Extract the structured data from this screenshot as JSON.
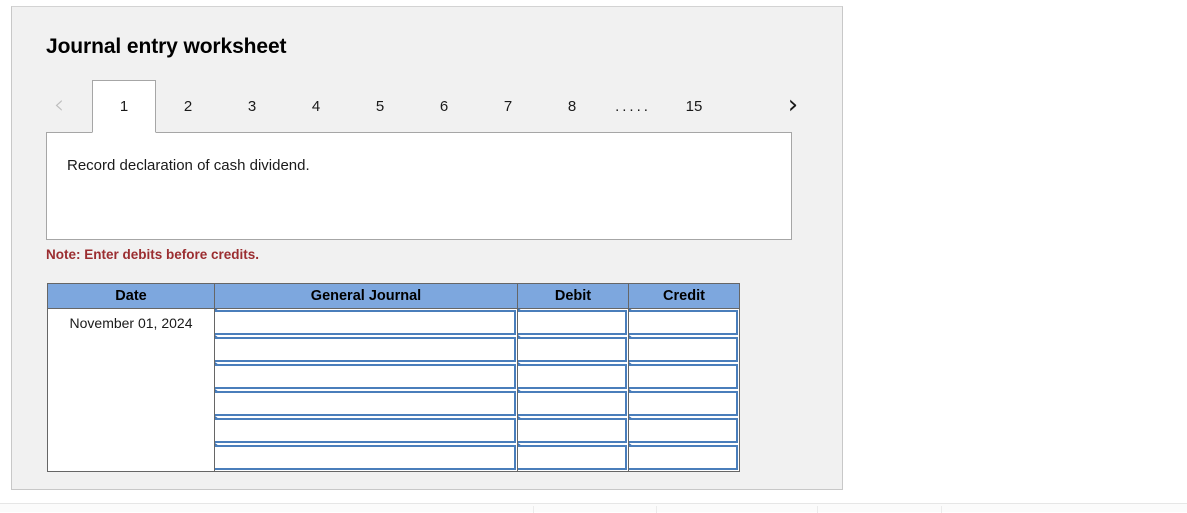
{
  "panel": {
    "title": "Journal entry worksheet"
  },
  "pagination": {
    "prev_icon": "chevron-left-icon",
    "next_icon": "chevron-right-icon",
    "prev_glyph": "‹",
    "next_glyph": "›",
    "active_page": "1",
    "tabs": [
      {
        "label": "1",
        "active": true
      },
      {
        "label": "2",
        "active": false
      },
      {
        "label": "3",
        "active": false
      },
      {
        "label": "4",
        "active": false
      },
      {
        "label": "5",
        "active": false
      },
      {
        "label": "6",
        "active": false
      },
      {
        "label": "7",
        "active": false
      },
      {
        "label": "8",
        "active": false
      },
      {
        "label": ".....",
        "active": false,
        "ellipsis": true
      },
      {
        "label": "15",
        "active": false
      }
    ]
  },
  "entry": {
    "description": "Record declaration of cash dividend."
  },
  "note": {
    "text": "Note: Enter debits before credits."
  },
  "journal_table": {
    "columns": [
      {
        "key": "date",
        "label": "Date"
      },
      {
        "key": "general_journal",
        "label": "General Journal"
      },
      {
        "key": "debit",
        "label": "Debit"
      },
      {
        "key": "credit",
        "label": "Credit"
      }
    ],
    "rows": [
      {
        "date": "November 01, 2024",
        "general_journal": "",
        "debit": "",
        "credit": ""
      },
      {
        "date": "",
        "general_journal": "",
        "debit": "",
        "credit": ""
      },
      {
        "date": "",
        "general_journal": "",
        "debit": "",
        "credit": ""
      },
      {
        "date": "",
        "general_journal": "",
        "debit": "",
        "credit": ""
      },
      {
        "date": "",
        "general_journal": "",
        "debit": "",
        "credit": ""
      },
      {
        "date": "",
        "general_journal": "",
        "debit": "",
        "credit": ""
      }
    ]
  },
  "colors": {
    "header_blue": "#7DA7DE",
    "input_border_blue": "#4a7ebb",
    "note_red": "#9b2d30",
    "panel_gray": "#f1f1f1"
  }
}
